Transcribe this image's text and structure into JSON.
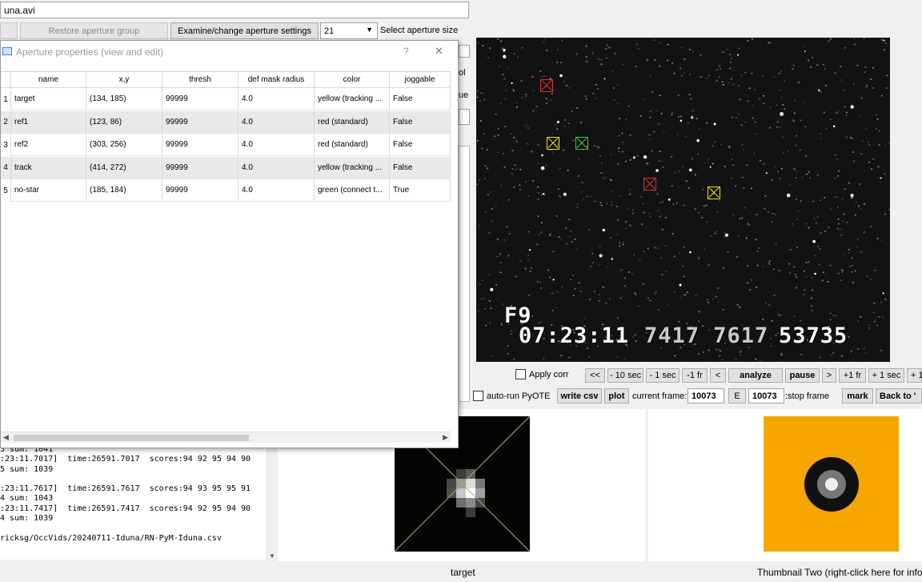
{
  "window": {
    "file_name": "una.avi"
  },
  "toolbar": {
    "restore_label": "Restore aperture group",
    "examine_label": "Examine/change aperture settings",
    "size_value": "21",
    "size_label": "Select aperture size",
    "clipped_right_1": "ol",
    "clipped_right_2": "ue"
  },
  "dialog": {
    "title": "Aperture properties (view and edit)",
    "help": "?",
    "close": "✕",
    "columns": [
      "name",
      "x,y",
      "thresh",
      "def mask radius",
      "color",
      "joggable"
    ],
    "rows": [
      {
        "num": "1",
        "name": "target",
        "xy": "(134, 185)",
        "thresh": "99999",
        "radius": "4.0",
        "color": "yellow (tracking ...",
        "joggable": "False"
      },
      {
        "num": "2",
        "name": "ref1",
        "xy": "(123, 86)",
        "thresh": "99999",
        "radius": "4.0",
        "color": "red (standard)",
        "joggable": "False"
      },
      {
        "num": "3",
        "name": "ref2",
        "xy": "(303, 256)",
        "thresh": "99999",
        "radius": "4.0",
        "color": "red (standard)",
        "joggable": "False"
      },
      {
        "num": "4",
        "name": "track",
        "xy": "(414, 272)",
        "thresh": "99999",
        "radius": "4.0",
        "color": "yellow (tracking ...",
        "joggable": "False"
      },
      {
        "num": "5",
        "name": "no-star",
        "xy": "(185, 184)",
        "thresh": "99999",
        "radius": "4.0",
        "color": "green (connect t...",
        "joggable": "True"
      }
    ]
  },
  "video": {
    "osd_line1": "F9",
    "osd_time": "07:23:11",
    "osd_dim": "7417 7617",
    "osd_frame": "53735"
  },
  "controls": {
    "apply_corr": "Apply corr",
    "auto_run": "auto-run PyOTE",
    "b_back10": "<<",
    "b_m10sec": "- 10 sec",
    "b_m1sec": "- 1 sec",
    "b_m1fr": "-1 fr",
    "b_back": "<",
    "b_analyze": "analyze",
    "b_pause": "pause",
    "b_fwd": ">",
    "b_p1fr": "+1 fr",
    "b_p1sec": "+ 1 sec",
    "b_p10sec": "+ 1",
    "write_csv": "write csv",
    "plot": "plot",
    "current_frame_label": "current frame:",
    "current_frame": "10073",
    "e_label": "E",
    "stop_frame": "10073",
    "stop_frame_label": ":stop frame",
    "mark": "mark",
    "back_to": "Back to '"
  },
  "log": {
    "lines": [
      "3 sum: 1041",
      ":23:11.7017]  time:26591.7017  scores:94 92 95 94 90",
      "5 sum: 1039",
      "",
      ":23:11.7617]  time:26591.7617  scores:94 93 95 95 91",
      "4 sum: 1043",
      ":23:11.7417]  time:26591.7417  scores:94 92 95 94 90",
      "4 sum: 1039",
      "",
      "ricksg/OccVids/20240711-Iduna/RN-PyM-Iduna.csv"
    ]
  },
  "status": {
    "target_label": "target",
    "thumb_two_label": "Thumbnail Two (right-click here for info)"
  },
  "colors": {
    "thumbnail_bg": "#f7a600",
    "ap_yellow": "#e8e800",
    "ap_red": "#e03030",
    "ap_green": "#2ecc40"
  }
}
